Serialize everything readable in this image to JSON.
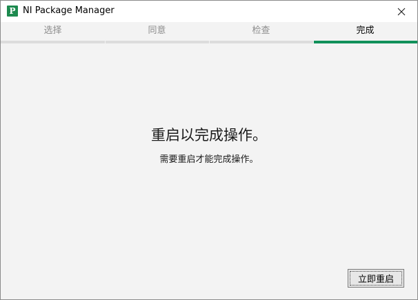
{
  "window": {
    "title": "NI Package Manager",
    "app_icon_letter": "P",
    "accent_color": "#10905a"
  },
  "tabs": [
    {
      "label": "选择",
      "active": false
    },
    {
      "label": "同意",
      "active": false
    },
    {
      "label": "检查",
      "active": false
    },
    {
      "label": "完成",
      "active": true
    }
  ],
  "main": {
    "heading": "重启以完成操作。",
    "subtext": "需要重启才能完成操作。",
    "restart_button_label": "立即重启"
  }
}
